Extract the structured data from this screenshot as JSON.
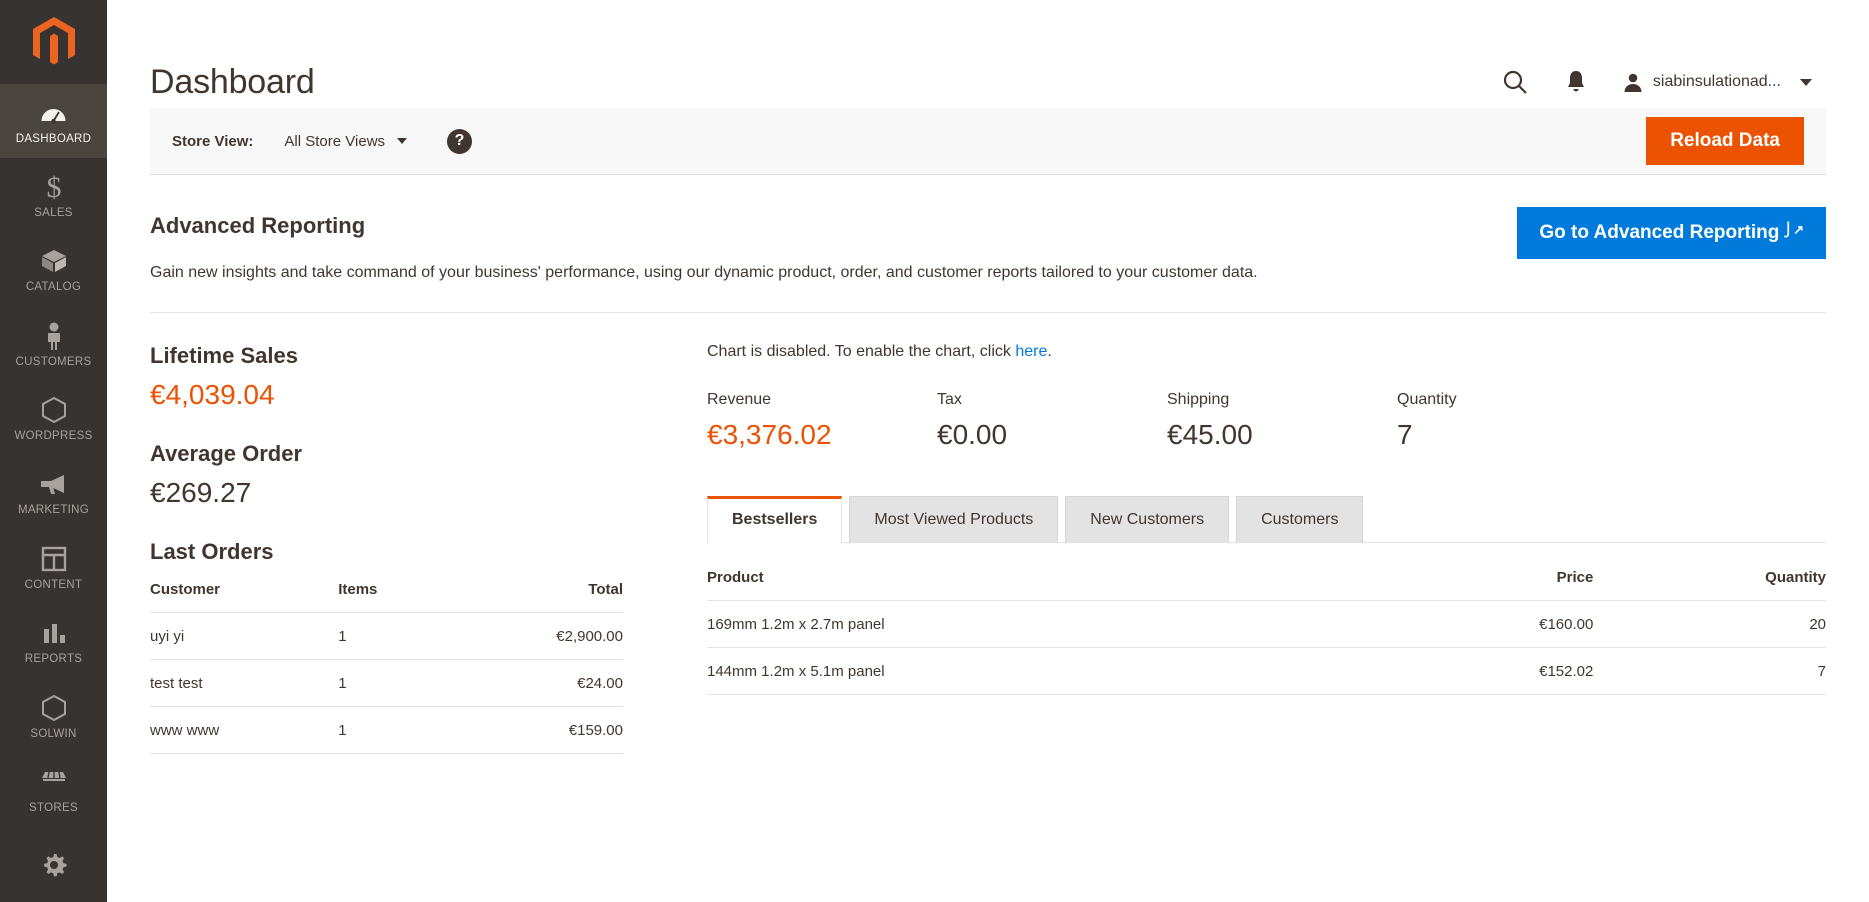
{
  "sidebar": {
    "logo": "magento-logo",
    "items": [
      {
        "label": "DASHBOARD",
        "icon": "gauge-icon",
        "active": true
      },
      {
        "label": "SALES",
        "icon": "dollar-icon",
        "active": false
      },
      {
        "label": "CATALOG",
        "icon": "box-icon",
        "active": false
      },
      {
        "label": "CUSTOMERS",
        "icon": "person-icon",
        "active": false
      },
      {
        "label": "WORDPRESS",
        "icon": "hexagon-icon",
        "active": false
      },
      {
        "label": "MARKETING",
        "icon": "megaphone-icon",
        "active": false
      },
      {
        "label": "CONTENT",
        "icon": "layout-icon",
        "active": false
      },
      {
        "label": "REPORTS",
        "icon": "bar-chart-icon",
        "active": false
      },
      {
        "label": "SOLWIN",
        "icon": "hexagon-icon",
        "active": false
      },
      {
        "label": "STORES",
        "icon": "storefront-icon",
        "active": false
      },
      {
        "label": "",
        "icon": "gear-icon",
        "active": false
      }
    ]
  },
  "header": {
    "title": "Dashboard",
    "search_icon": "search-icon",
    "notifications_icon": "bell-icon",
    "admin_user": "siabinsulationad...",
    "avatar_icon": "user-avatar-icon",
    "caret_icon": "chevron-down-icon"
  },
  "storebar": {
    "label": "Store View:",
    "selected": "All Store Views",
    "help_icon": "question-mark-icon",
    "reload_label": "Reload Data"
  },
  "advanced_reporting": {
    "title": "Advanced Reporting",
    "description": "Gain new insights and take command of your business' performance, using our dynamic product, order, and customer reports tailored to your customer data.",
    "button_label": "Go to Advanced Reporting",
    "button_icon": "external-link-icon"
  },
  "left_column": {
    "lifetime_sales_title": "Lifetime Sales",
    "lifetime_sales_value": "€4,039.04",
    "average_order_title": "Average Order",
    "average_order_value": "€269.27",
    "last_orders_title": "Last Orders",
    "last_orders_headers": {
      "customer": "Customer",
      "items": "Items",
      "total": "Total"
    },
    "last_orders_rows": [
      {
        "customer": "uyi yi",
        "items": "1",
        "total": "€2,900.00"
      },
      {
        "customer": "test test",
        "items": "1",
        "total": "€24.00"
      },
      {
        "customer": "www www",
        "items": "1",
        "total": "€159.00"
      }
    ]
  },
  "right_column": {
    "chart_message_prefix": "Chart is disabled. To enable the chart, click ",
    "chart_message_link": "here",
    "chart_message_suffix": ".",
    "stats": [
      {
        "label": "Revenue",
        "value": "€3,376.02",
        "orange": true
      },
      {
        "label": "Tax",
        "value": "€0.00",
        "orange": false
      },
      {
        "label": "Shipping",
        "value": "€45.00",
        "orange": false
      },
      {
        "label": "Quantity",
        "value": "7",
        "orange": false
      }
    ],
    "tabs": [
      {
        "label": "Bestsellers",
        "active": true
      },
      {
        "label": "Most Viewed Products",
        "active": false
      },
      {
        "label": "New Customers",
        "active": false
      },
      {
        "label": "Customers",
        "active": false
      }
    ],
    "bestsellers_headers": {
      "product": "Product",
      "price": "Price",
      "quantity": "Quantity"
    },
    "bestsellers_rows": [
      {
        "product": "169mm 1.2m x 2.7m panel",
        "price": "€160.00",
        "quantity": "20"
      },
      {
        "product": "144mm 1.2m x 5.1m panel",
        "price": "€152.02",
        "quantity": "7"
      }
    ]
  },
  "colors": {
    "accent_orange": "#eb5202",
    "link_blue": "#007bdb",
    "sidebar_bg": "#373330",
    "sidebar_active": "#4a453f",
    "text_dark": "#41362f"
  }
}
